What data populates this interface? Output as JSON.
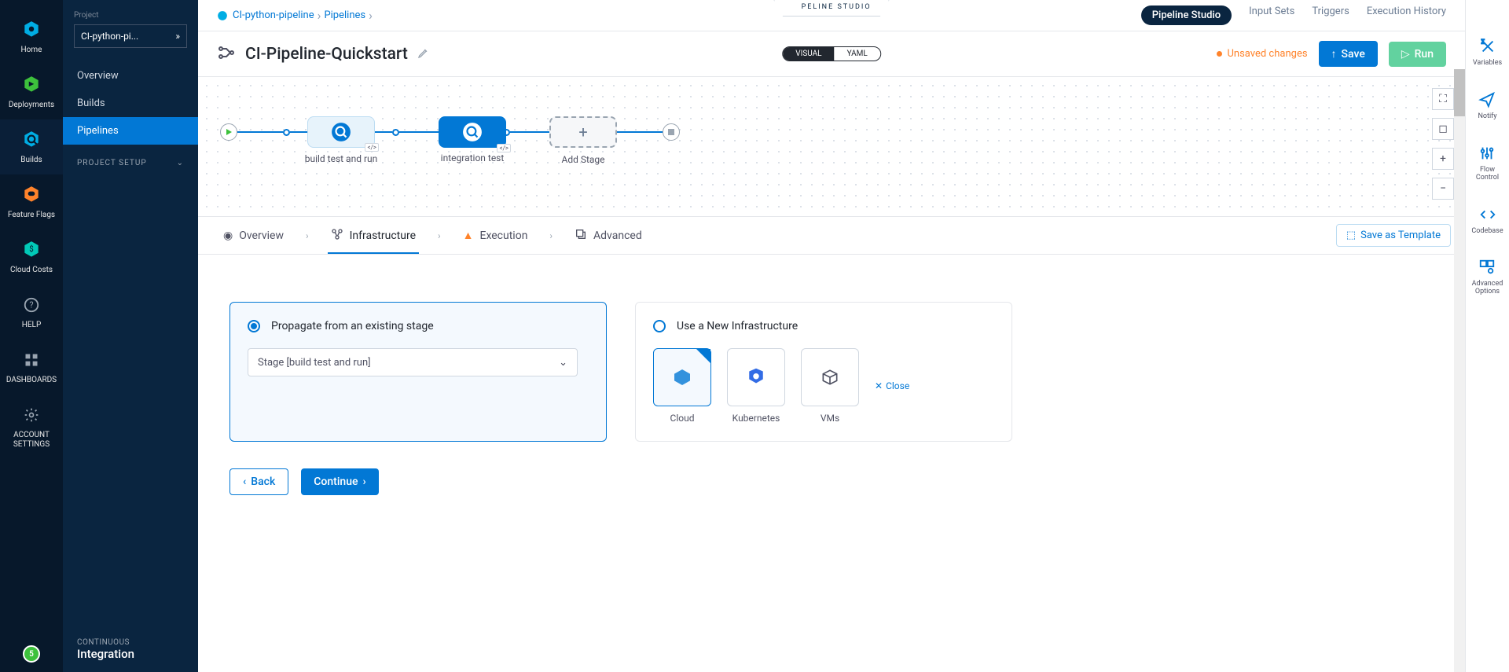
{
  "rail": {
    "items": [
      {
        "label": "Home"
      },
      {
        "label": "Deployments"
      },
      {
        "label": "Builds"
      },
      {
        "label": "Feature Flags"
      },
      {
        "label": "Cloud Costs"
      },
      {
        "label": "HELP"
      },
      {
        "label": "DASHBOARDS"
      },
      {
        "label": "ACCOUNT\nSETTINGS"
      }
    ],
    "badge": "5"
  },
  "sidebar": {
    "project_label": "Project",
    "project_value": "CI-python-pi...",
    "nav": [
      "Overview",
      "Builds",
      "Pipelines"
    ],
    "setup": "PROJECT SETUP",
    "footer_small": "CONTINUOUS",
    "footer_big": "Integration"
  },
  "breadcrumb": {
    "proj": "CI-python-pipeline",
    "section": "Pipelines"
  },
  "studio_badge": "PIPELINE STUDIO",
  "top_tabs": [
    "Pipeline Studio",
    "Input Sets",
    "Triggers",
    "Execution History"
  ],
  "title": "CI-Pipeline-Quickstart",
  "view_toggle": {
    "a": "VISUAL",
    "b": "YAML"
  },
  "unsaved": "Unsaved changes",
  "save_label": "Save",
  "run_label": "Run",
  "stages": {
    "s1": "build test and run",
    "s2": "integration test",
    "add": "Add Stage"
  },
  "stage_tabs": {
    "overview": "Overview",
    "infra": "Infrastructure",
    "exec": "Execution",
    "adv": "Advanced"
  },
  "save_template": "Save as Template",
  "infra": {
    "propagate_label": "Propagate from an existing stage",
    "stage_select": "Stage [build test and run]",
    "new_label": "Use a New Infrastructure",
    "opts": {
      "cloud": "Cloud",
      "k8s": "Kubernetes",
      "vms": "VMs"
    },
    "close": "Close"
  },
  "buttons": {
    "back": "Back",
    "cont": "Continue"
  },
  "rrail": [
    "Variables",
    "Notify",
    "Flow\nControl",
    "Codebase",
    "Advanced\nOptions"
  ]
}
